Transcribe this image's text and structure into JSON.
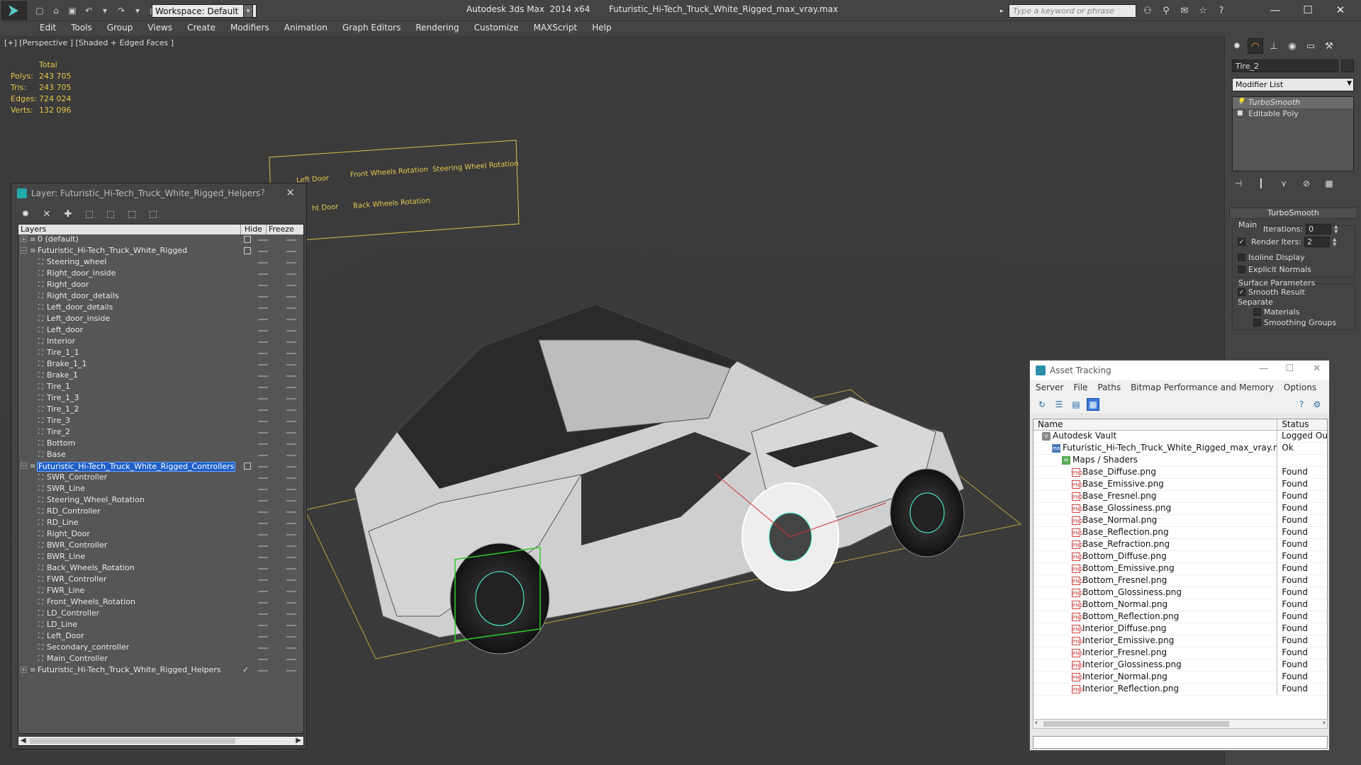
{
  "app": {
    "title": "Autodesk 3ds Max  2014 x64       Futuristic_Hi-Tech_Truck_White_Rigged_max_vray.max",
    "workspace": "Workspace: Default",
    "search_placeholder": "Type a keyword or phrase",
    "menu": [
      "Edit",
      "Tools",
      "Group",
      "Views",
      "Create",
      "Modifiers",
      "Animation",
      "Graph Editors",
      "Rendering",
      "Customize",
      "MAXScript",
      "Help"
    ]
  },
  "viewport": {
    "label": "[+] [Perspective ] [Shaded + Edged Faces ]",
    "stats_header": "Total",
    "stats": [
      {
        "k": "Polys:",
        "v": "243 705"
      },
      {
        "k": "Tris:",
        "v": "243 705"
      },
      {
        "k": "Edges:",
        "v": "724 024"
      },
      {
        "k": "Verts:",
        "v": "132 096"
      }
    ],
    "controller_labels": [
      "Left Door",
      "Front Wheels Rotation",
      "Steering Wheel Rotation",
      "ht Door",
      "Back Wheels Rotation"
    ]
  },
  "command_panel": {
    "object_name": "Tire_2",
    "modifier_list": "Modifier List",
    "stack": [
      {
        "label": "TurboSmooth",
        "selected": true
      },
      {
        "label": "Editable Poly",
        "selected": false
      }
    ],
    "rollout_title": "TurboSmooth",
    "main_group": "Main",
    "iterations_label": "Iterations:",
    "iterations_value": "0",
    "render_iters_label": "Render Iters:",
    "render_iters_value": "2",
    "isoline_label": "Isoline Display",
    "explicit_normals_label": "Explicit Normals",
    "surface_group": "Surface Parameters",
    "smooth_result_label": "Smooth Result",
    "separate_label": "Separate",
    "materials_label": "Materials",
    "smoothing_groups_label": "Smoothing Groups"
  },
  "layer_window": {
    "title": "Layer: Futuristic_Hi-Tech_Truck_White_Rigged_Helpers",
    "col_layers": "Layers",
    "col_hide": "Hide",
    "col_freeze": "Freeze",
    "rows": [
      {
        "name": "0 (default)",
        "level": 0,
        "exp": false,
        "mark": "box"
      },
      {
        "name": "Futuristic_Hi-Tech_Truck_White_Rigged",
        "level": 0,
        "exp": true,
        "mark": "box"
      },
      {
        "name": "Steering_wheel",
        "level": 1
      },
      {
        "name": "Right_door_inside",
        "level": 1
      },
      {
        "name": "Right_door",
        "level": 1
      },
      {
        "name": "Right_door_details",
        "level": 1
      },
      {
        "name": "Left_door_details",
        "level": 1
      },
      {
        "name": "Left_door_inside",
        "level": 1
      },
      {
        "name": "Left_door",
        "level": 1
      },
      {
        "name": "Interior",
        "level": 1
      },
      {
        "name": "Tire_1_1",
        "level": 1
      },
      {
        "name": "Brake_1_1",
        "level": 1
      },
      {
        "name": "Brake_1",
        "level": 1
      },
      {
        "name": "Tire_1",
        "level": 1
      },
      {
        "name": "Tire_1_3",
        "level": 1
      },
      {
        "name": "Tire_1_2",
        "level": 1
      },
      {
        "name": "Tire_3",
        "level": 1
      },
      {
        "name": "Tire_2",
        "level": 1
      },
      {
        "name": "Bottom",
        "level": 1
      },
      {
        "name": "Base",
        "level": 1
      },
      {
        "name": "Futuristic_Hi-Tech_Truck_White_Rigged_Controllers",
        "level": 0,
        "exp": true,
        "mark": "box",
        "selected": true
      },
      {
        "name": "SWR_Controller",
        "level": 1
      },
      {
        "name": "SWR_Line",
        "level": 1
      },
      {
        "name": "Steering_Wheel_Rotation",
        "level": 1
      },
      {
        "name": "RD_Controller",
        "level": 1
      },
      {
        "name": "RD_Line",
        "level": 1
      },
      {
        "name": "Right_Door",
        "level": 1
      },
      {
        "name": "BWR_Controller",
        "level": 1
      },
      {
        "name": "BWR_Line",
        "level": 1
      },
      {
        "name": "Back_Wheels_Rotation",
        "level": 1
      },
      {
        "name": "FWR_Controller",
        "level": 1
      },
      {
        "name": "FWR_Line",
        "level": 1
      },
      {
        "name": "Front_Wheels_Rotation",
        "level": 1
      },
      {
        "name": "LD_Controller",
        "level": 1
      },
      {
        "name": "LD_Line",
        "level": 1
      },
      {
        "name": "Left_Door",
        "level": 1
      },
      {
        "name": "Secondary_controller",
        "level": 1
      },
      {
        "name": "Main_Controller",
        "level": 1
      },
      {
        "name": "Futuristic_Hi-Tech_Truck_White_Rigged_Helpers",
        "level": 0,
        "exp": false,
        "mark": "check"
      }
    ]
  },
  "asset_window": {
    "title": "Asset Tracking",
    "menu": [
      "Server",
      "File",
      "Paths",
      "Bitmap Performance and Memory",
      "Options"
    ],
    "col_name": "Name",
    "col_status": "Status",
    "rows": [
      {
        "name": "Autodesk Vault",
        "status": "Logged Out",
        "indent": 1,
        "icon": "vault"
      },
      {
        "name": "Futuristic_Hi-Tech_Truck_White_Rigged_max_vray.max",
        "status": "Ok",
        "indent": 2,
        "icon": "file"
      },
      {
        "name": "Maps / Shaders",
        "status": "",
        "indent": 3,
        "icon": "maps"
      },
      {
        "name": "Base_Diffuse.png",
        "status": "Found",
        "indent": 4,
        "icon": "png"
      },
      {
        "name": "Base_Emissive.png",
        "status": "Found",
        "indent": 4,
        "icon": "png"
      },
      {
        "name": "Base_Fresnel.png",
        "status": "Found",
        "indent": 4,
        "icon": "png"
      },
      {
        "name": "Base_Glossiness.png",
        "status": "Found",
        "indent": 4,
        "icon": "png"
      },
      {
        "name": "Base_Normal.png",
        "status": "Found",
        "indent": 4,
        "icon": "png"
      },
      {
        "name": "Base_Reflection.png",
        "status": "Found",
        "indent": 4,
        "icon": "png"
      },
      {
        "name": "Base_Refraction.png",
        "status": "Found",
        "indent": 4,
        "icon": "png"
      },
      {
        "name": "Bottom_Diffuse.png",
        "status": "Found",
        "indent": 4,
        "icon": "png"
      },
      {
        "name": "Bottom_Emissive.png",
        "status": "Found",
        "indent": 4,
        "icon": "png"
      },
      {
        "name": "Bottom_Fresnel.png",
        "status": "Found",
        "indent": 4,
        "icon": "png"
      },
      {
        "name": "Bottom_Glossiness.png",
        "status": "Found",
        "indent": 4,
        "icon": "png"
      },
      {
        "name": "Bottom_Normal.png",
        "status": "Found",
        "indent": 4,
        "icon": "png"
      },
      {
        "name": "Bottom_Reflection.png",
        "status": "Found",
        "indent": 4,
        "icon": "png"
      },
      {
        "name": "Interior_Diffuse.png",
        "status": "Found",
        "indent": 4,
        "icon": "png"
      },
      {
        "name": "Interior_Emissive.png",
        "status": "Found",
        "indent": 4,
        "icon": "png"
      },
      {
        "name": "Interior_Fresnel.png",
        "status": "Found",
        "indent": 4,
        "icon": "png"
      },
      {
        "name": "Interior_Glossiness.png",
        "status": "Found",
        "indent": 4,
        "icon": "png"
      },
      {
        "name": "Interior_Normal.png",
        "status": "Found",
        "indent": 4,
        "icon": "png"
      },
      {
        "name": "Interior_Reflection.png",
        "status": "Found",
        "indent": 4,
        "icon": "png"
      }
    ]
  },
  "colors": {
    "selection": "#1f5fc8",
    "stats_text": "#e3c64a",
    "selection_box": "#2ecc2e"
  }
}
